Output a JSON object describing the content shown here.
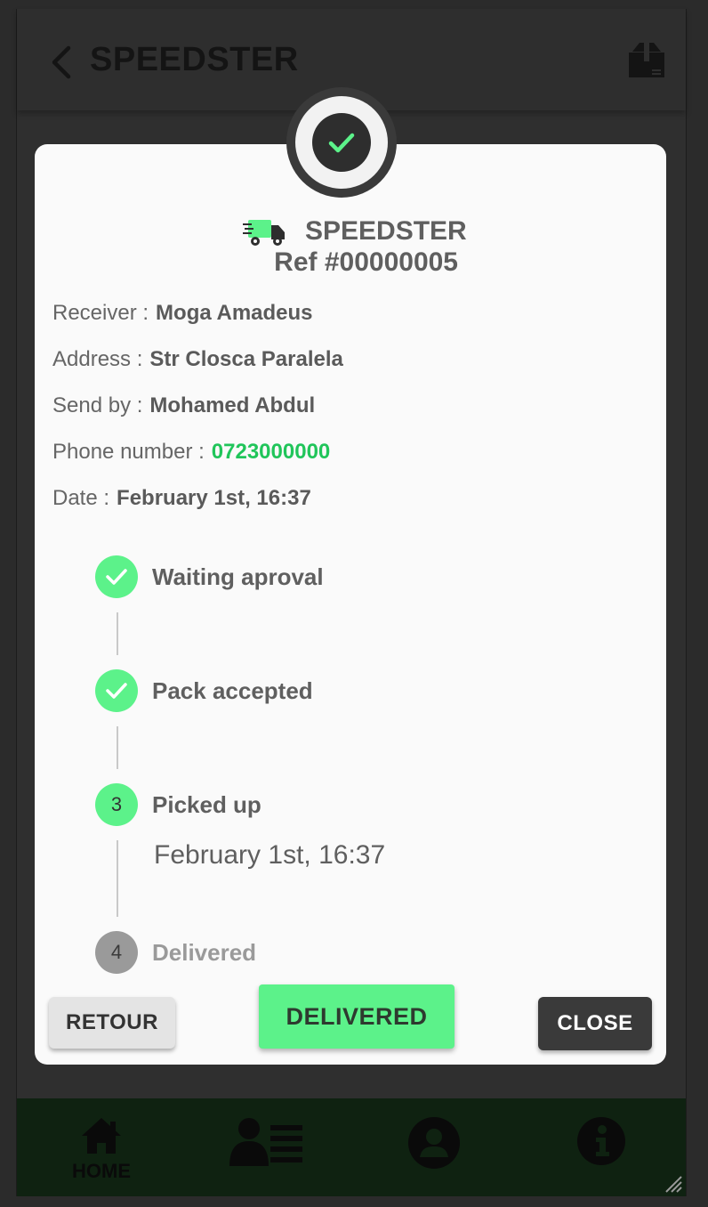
{
  "header": {
    "title": "SPEEDSTER",
    "back_icon": "chevron-left-icon",
    "right_icon": "package-icon"
  },
  "modal": {
    "status_icon": "check-circle-icon",
    "brand_name": "SPEEDSTER",
    "brand_icon": "delivery-truck-icon",
    "ref": "Ref #00000005",
    "info": {
      "receiver_label": "Receiver :",
      "receiver_value": "Moga Amadeus",
      "address_label": "Address :",
      "address_value": "Str Closca Paralela",
      "sendby_label": "Send by :",
      "sendby_value": "Mohamed Abdul",
      "phone_label": "Phone number :",
      "phone_value": "0723000000",
      "date_label": "Date :",
      "date_value": "February 1st, 16:37"
    },
    "steps": [
      {
        "label": "Waiting aproval",
        "state": "done"
      },
      {
        "label": "Pack accepted",
        "state": "done"
      },
      {
        "number": "3",
        "label": "Picked up",
        "state": "active",
        "date": "February 1st, 16:37"
      },
      {
        "number": "4",
        "label": "Delivered",
        "state": "pending"
      }
    ],
    "buttons": {
      "retour": "RETOUR",
      "delivered": "DELIVERED",
      "close": "CLOSE"
    }
  },
  "bottom_nav": {
    "items": [
      {
        "label": "HOME",
        "icon": "home-icon"
      },
      {
        "label": "",
        "icon": "user-list-icon"
      },
      {
        "label": "",
        "icon": "account-icon"
      },
      {
        "label": "",
        "icon": "info-icon"
      }
    ]
  },
  "colors": {
    "accent_green": "#5cf28a",
    "phone_green": "#20c55a",
    "dark": "#3a3a3a"
  }
}
